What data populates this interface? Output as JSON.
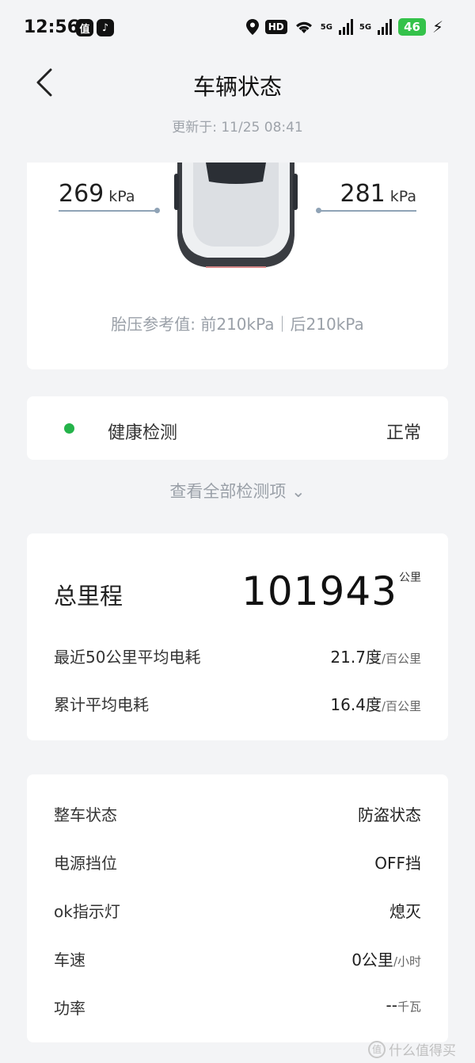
{
  "status_bar": {
    "time": "12:56",
    "app_icon_1": "值",
    "app_icon_2": "♪",
    "hd": "HD",
    "sig1": "5G",
    "sig2": "5G",
    "battery": "46"
  },
  "header": {
    "title": "车辆状态",
    "updated": "更新于: 11/25 08:41"
  },
  "tire": {
    "left_value": "269",
    "left_unit": "kPa",
    "right_value": "281",
    "right_unit": "kPa",
    "reference": "胎压参考值:  前210kPa｜后210kPa"
  },
  "health": {
    "label": "健康检测",
    "status": "正常",
    "status_color": "#24b34a",
    "view_all": "查看全部检测项 ⌄"
  },
  "mileage": {
    "label": "总里程",
    "value": "101943",
    "unit": "公里",
    "rows": [
      {
        "label": "最近50公里平均电耗",
        "value": "21.7度",
        "unit": "/百公里"
      },
      {
        "label": "累计平均电耗",
        "value": "16.4度",
        "unit": "/百公里"
      }
    ]
  },
  "vehicle_status": {
    "rows": [
      {
        "label": "整车状态",
        "value": "防盗状态",
        "unit": ""
      },
      {
        "label": "电源挡位",
        "value": "OFF挡",
        "unit": ""
      },
      {
        "label": "ok指示灯",
        "value": "熄灭",
        "unit": ""
      },
      {
        "label": "车速",
        "value": "0公里",
        "unit": "/小时"
      },
      {
        "label": "功率",
        "value": "--",
        "unit": "千瓦"
      }
    ]
  },
  "watermark": {
    "icon": "值",
    "text": "什么值得买"
  }
}
